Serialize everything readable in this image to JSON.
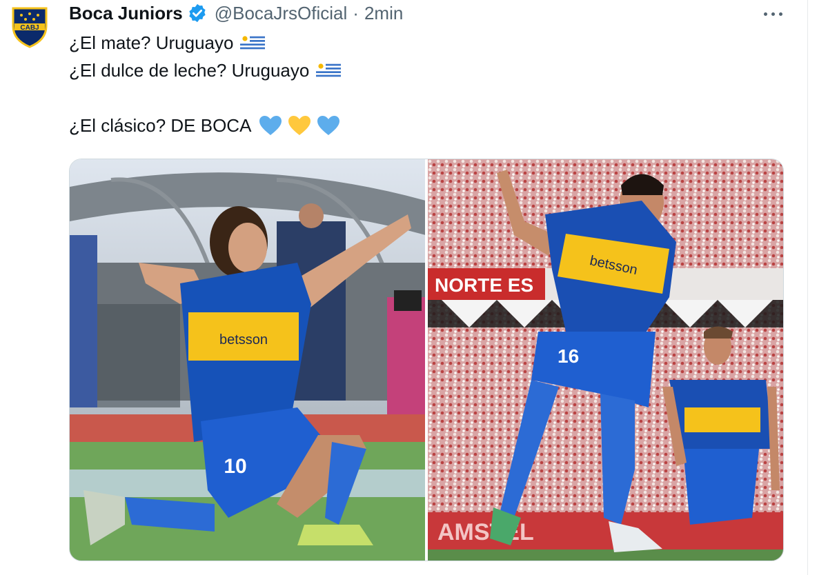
{
  "tweet": {
    "display_name": "Boca Juniors",
    "handle": "@BocaJrsOficial",
    "separator": "·",
    "time": "2min",
    "avatar_text": "CABJ",
    "lines": [
      "¿El mate? Uruguayo",
      "¿El dulce de leche? Uruguayo",
      "",
      "¿El clásico? DE BOCA"
    ],
    "hearts": [
      "blue-heart-icon",
      "yellow-heart-icon",
      "blue-heart-icon"
    ],
    "photos": [
      {
        "shirt_number": "10",
        "sponsor": "betsson"
      },
      {
        "shirt_number": "16",
        "sponsor": "betsson",
        "banner": "NORTE ES",
        "board": "AMSTEL"
      }
    ]
  },
  "colors": {
    "boca_blue": "#1652b8",
    "boca_yellow": "#f5c21b",
    "heart_blue": "#5dadec",
    "heart_yellow": "#ffc83d",
    "verified": "#1d9bf0",
    "secondary_text": "#536471"
  }
}
